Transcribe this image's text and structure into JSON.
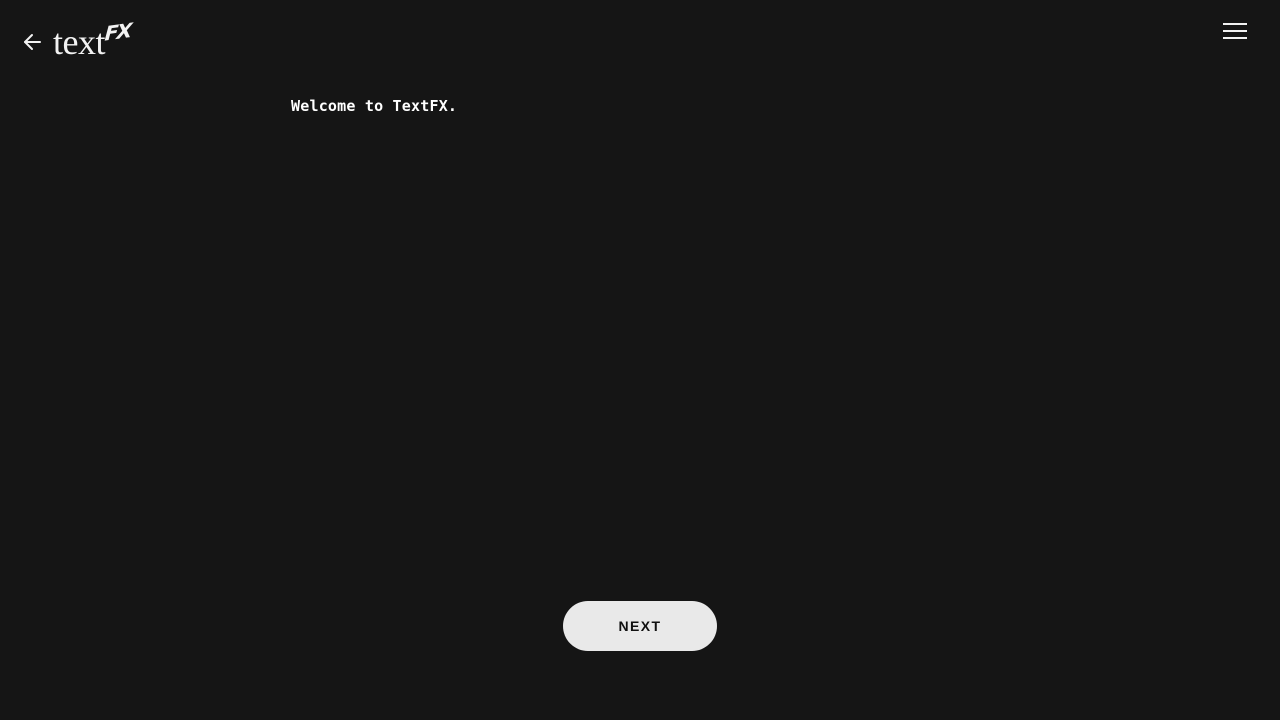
{
  "header": {
    "back_icon": "arrow-left-icon",
    "logo": {
      "text": "text",
      "mark": "FX"
    },
    "menu_icon": "hamburger-menu-icon"
  },
  "main": {
    "message": "Welcome to TextFX."
  },
  "footer": {
    "next_label": "NEXT"
  },
  "colors": {
    "background": "#151515",
    "foreground": "#ffffff",
    "button_background": "#e9e9e9",
    "button_text": "#111111"
  }
}
